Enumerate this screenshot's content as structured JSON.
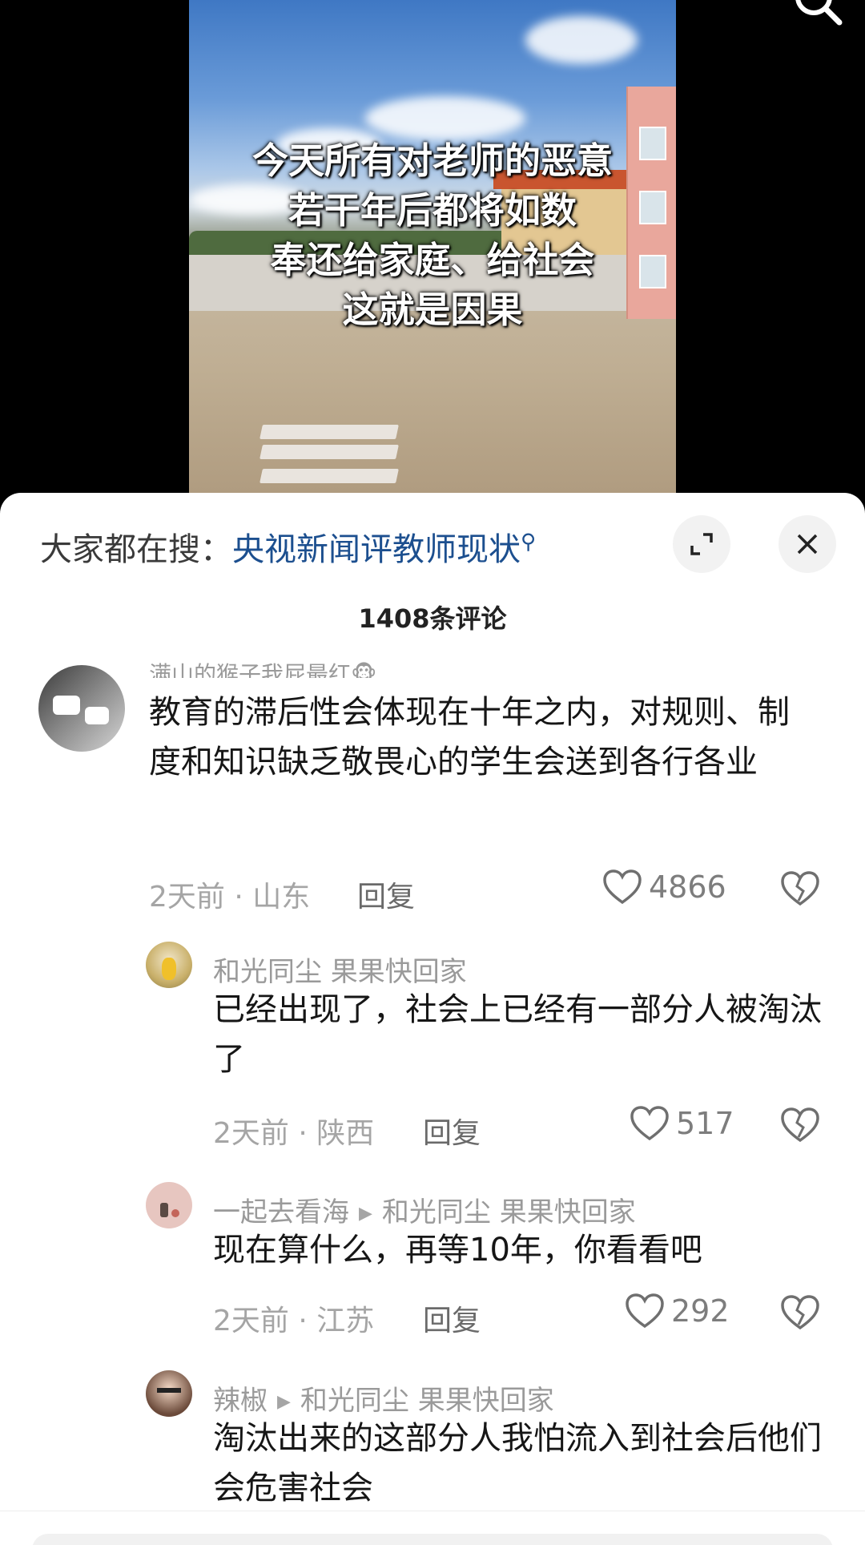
{
  "video": {
    "caption_lines": [
      "今天所有对老师的恶意",
      "若干年后都将如数",
      "奉还给家庭、给社会",
      "这就是因果"
    ]
  },
  "search_bar": {
    "prefix": "大家都在搜：",
    "query": "央视新闻评教师现状"
  },
  "comment_count": "1408条评论",
  "comments": [
    {
      "user": "满山的猴子我屁最红🐵",
      "text": "教育的滞后性会体现在十年之内，对规则、制度和知识缺乏敬畏心的学生会送到各行各业",
      "time_location": "2天前 · 山东",
      "reply_label": "回复",
      "likes": "4866"
    },
    {
      "user": "和光同尘 果果快回家",
      "text": "已经出现了，社会上已经有一部分人被淘汰了",
      "time_location": "2天前 · 陕西",
      "reply_label": "回复",
      "likes": "517"
    },
    {
      "user": "一起去看海",
      "reply_to": "和光同尘 果果快回家",
      "text": "现在算什么，再等10年，你看看吧",
      "time_location": "2天前 · 江苏",
      "reply_label": "回复",
      "likes": "292"
    },
    {
      "user": "辣椒",
      "reply_to": "和光同尘 果果快回家",
      "text": "淘汰出来的这部分人我怕流入到社会后他们会危害社会",
      "time_location": "",
      "reply_label": "",
      "likes": ""
    }
  ]
}
